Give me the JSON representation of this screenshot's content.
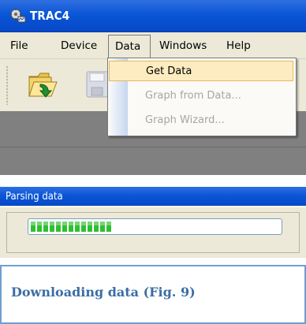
{
  "window1": {
    "title": "TRAC4",
    "menu": [
      "File",
      "Device",
      "Data",
      "Windows",
      "Help"
    ],
    "data_menu": {
      "items": [
        {
          "label": "Get Data",
          "enabled": true,
          "highlighted": true
        },
        {
          "label": "Graph from Data...",
          "enabled": false,
          "highlighted": false
        },
        {
          "label": "Graph Wizard...",
          "enabled": false,
          "highlighted": false
        }
      ]
    },
    "toolbar": {
      "buttons": [
        "open-folder-icon",
        "save-disk-icon"
      ]
    },
    "colors": {
      "titlebar": "#0a56d6",
      "menu_highlight": "#fdecc0",
      "workspace": "#808080"
    }
  },
  "window2": {
    "title": "Parsing data",
    "progress": 0.33
  },
  "caption": "Downloading data (Fig. 9)"
}
